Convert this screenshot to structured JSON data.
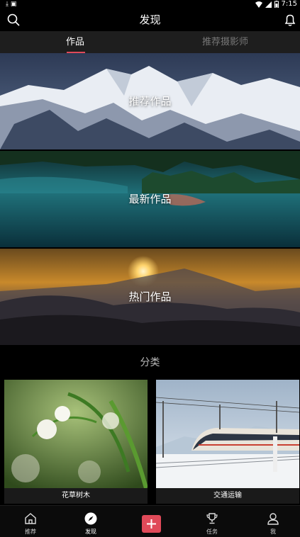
{
  "status_bar": {
    "left_icons": "⤓ ▣",
    "time": "7:15"
  },
  "header": {
    "title": "发现"
  },
  "tabs": [
    {
      "label": "作品",
      "active": true
    },
    {
      "label": "推荐摄影师",
      "active": false
    }
  ],
  "banners": [
    {
      "label": "推荐作品"
    },
    {
      "label": "最新作品"
    },
    {
      "label": "热门作品"
    }
  ],
  "category_section": {
    "title": "分类",
    "items": [
      {
        "label": "花草树木"
      },
      {
        "label": "交通运输"
      }
    ]
  },
  "bottom_nav": {
    "items": [
      {
        "label": "推荐",
        "icon": "home-icon"
      },
      {
        "label": "发现",
        "icon": "compass-icon"
      },
      {
        "label": "",
        "icon": "plus-icon"
      },
      {
        "label": "任务",
        "icon": "trophy-icon"
      },
      {
        "label": "我",
        "icon": "user-icon"
      }
    ]
  },
  "colors": {
    "accent": "#e04a59",
    "tab_bar": "#1e1e1e"
  }
}
